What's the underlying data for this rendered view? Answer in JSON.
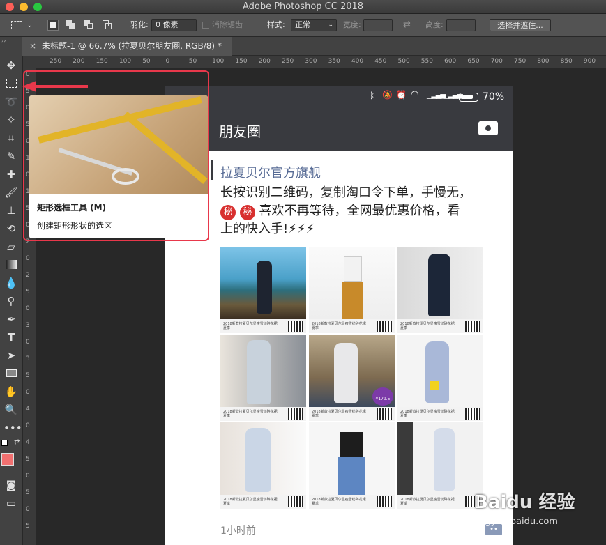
{
  "app": {
    "title": "Adobe Photoshop CC 2018"
  },
  "options": {
    "feather_label": "羽化:",
    "feather_value": "0 像素",
    "antialias_label": "消除锯齿",
    "style_label": "样式:",
    "style_value": "正常",
    "width_label": "宽度:",
    "height_label": "高度:",
    "select_mask_button": "选择并遮住..."
  },
  "document": {
    "tab_title": "未标题-1 @ 66.7% (拉夏贝尔朋友圈, RGB/8) *",
    "close": "×"
  },
  "rulers": {
    "h_ticks": [
      "250",
      "200",
      "150",
      "100",
      "50",
      "0",
      "50",
      "100",
      "150",
      "200",
      "250",
      "300",
      "350",
      "400",
      "450",
      "500",
      "550",
      "600",
      "650",
      "700",
      "750",
      "800",
      "850",
      "900"
    ],
    "v_ticks": [
      "0",
      "5",
      "0",
      "5",
      "0",
      "1",
      "0",
      "1",
      "5",
      "0",
      "2",
      "0",
      "2",
      "5",
      "0",
      "3",
      "0",
      "3",
      "5",
      "0",
      "4",
      "0",
      "4",
      "5",
      "0",
      "5",
      "0",
      "5"
    ]
  },
  "tooltip": {
    "tool_name": "矩形选框工具 (M)",
    "description": "创建矩形形状的选区"
  },
  "phone": {
    "battery": "70%",
    "nav_title": "朋友圈",
    "poster_name": "拉夏贝尔官方旗舰",
    "line1": "长按识别二维码，复制淘口令下单，手慢无，",
    "line2_badges": [
      "秘",
      "秘"
    ],
    "line2": "喜欢不再等待，全网最优惠价格，看",
    "line3": "上的快入手!⚡⚡⚡",
    "caption": "2018新款拉夏贝尔显瘦雪纺碎花裙夏季",
    "price_badge": "¥179.5",
    "time": "1小时前"
  },
  "watermark": {
    "text": "Baidu 经验",
    "sub": "jingyan.baidu.com"
  }
}
